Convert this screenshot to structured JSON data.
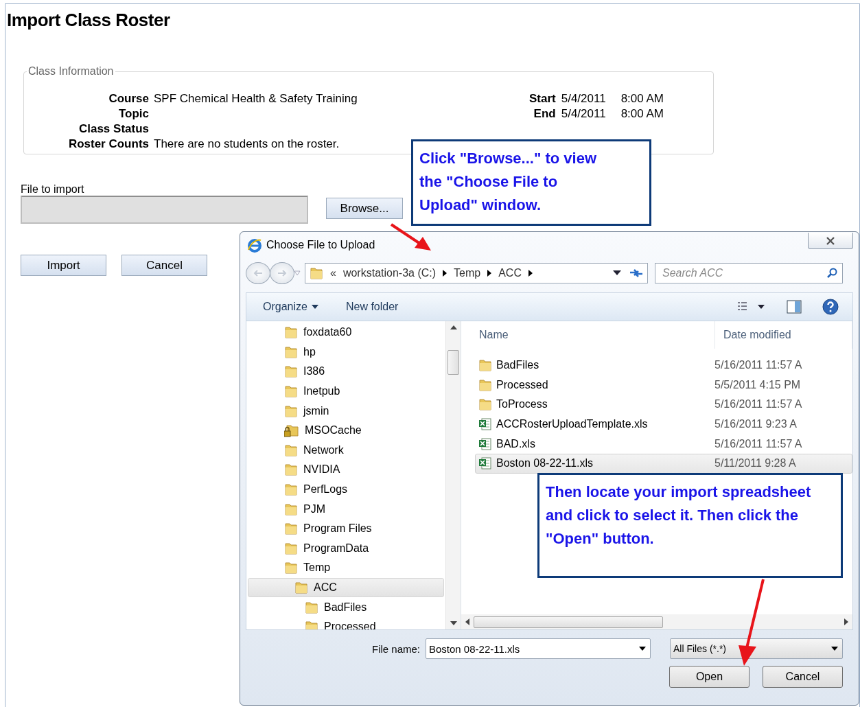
{
  "page": {
    "title": "Import Class Roster",
    "class_info": {
      "legend": "Class Information",
      "left": [
        {
          "label": "Course",
          "value": "SPF Chemical Health & Safety Training"
        },
        {
          "label": "Topic"
        },
        {
          "label": "Class Status"
        },
        {
          "label": "Roster Counts",
          "value": "There are no students on the roster."
        }
      ],
      "right": [
        {
          "label": "Start",
          "date": "5/4/2011",
          "time": "8:00 AM"
        },
        {
          "label": "End",
          "date": "5/4/2011",
          "time": "8:00 AM"
        }
      ]
    },
    "file_label": "File to import",
    "browse": "Browse...",
    "actions": [
      "Import",
      "Cancel"
    ]
  },
  "dialog": {
    "title": "Choose File to Upload",
    "breadcrumb": {
      "overflow": "«",
      "parts": [
        "workstation-3a (C:)",
        "Temp",
        "ACC"
      ]
    },
    "search_placeholder": "Search ACC",
    "toolbar": {
      "organize": "Organize",
      "new_folder": "New folder"
    },
    "tree": [
      {
        "label": "foxdata60",
        "locked": false,
        "selected": false
      },
      {
        "label": "hp",
        "locked": false,
        "selected": false
      },
      {
        "label": "I386",
        "locked": false,
        "selected": false
      },
      {
        "label": "Inetpub",
        "locked": false,
        "selected": false
      },
      {
        "label": "jsmin",
        "locked": false,
        "selected": false
      },
      {
        "label": "MSOCache",
        "locked": true,
        "selected": false
      },
      {
        "label": "Network",
        "locked": false,
        "selected": false
      },
      {
        "label": "NVIDIA",
        "locked": false,
        "selected": false
      },
      {
        "label": "PerfLogs",
        "locked": false,
        "selected": false
      },
      {
        "label": "PJM",
        "locked": false,
        "selected": false
      },
      {
        "label": "Program Files",
        "locked": false,
        "selected": false
      },
      {
        "label": "ProgramData",
        "locked": false,
        "selected": false
      },
      {
        "label": "Temp",
        "locked": false,
        "selected": false,
        "children": [
          {
            "label": "ACC",
            "locked": false,
            "selected": true,
            "children": [
              {
                "label": "BadFiles",
                "locked": false,
                "selected": false
              },
              {
                "label": "Processed",
                "locked": false,
                "selected": false
              }
            ]
          }
        ]
      }
    ],
    "columns": [
      "Name",
      "Date modified"
    ],
    "files": [
      {
        "name": "BadFiles",
        "kind": "folder",
        "date": "5/16/2011 11:57 A",
        "selected": false
      },
      {
        "name": "Processed",
        "kind": "folder",
        "date": "5/5/2011 4:15 PM",
        "selected": false
      },
      {
        "name": "ToProcess",
        "kind": "folder",
        "date": "5/16/2011 11:57 A",
        "selected": false
      },
      {
        "name": "ACCRosterUploadTemplate.xls",
        "kind": "sheet",
        "date": "5/16/2011 9:23 A",
        "selected": false
      },
      {
        "name": "BAD.xls",
        "kind": "sheet",
        "date": "5/16/2011 11:57 A",
        "selected": false
      },
      {
        "name": "Boston 08-22-11.xls",
        "kind": "sheet",
        "date": "5/11/2011 9:28 A",
        "selected": true
      }
    ],
    "file_name_label": "File name:",
    "file_name": "Boston 08-22-11.xls",
    "filter": "All Files (*.*)",
    "buttons": [
      "Open",
      "Cancel"
    ]
  },
  "callouts": [
    {
      "text": "Click \"Browse...\" to view the \"Choose File to Upload\" window."
    },
    {
      "text": "Then locate your import spreadsheet and click to select it.  Then click the \"Open\" button."
    }
  ]
}
